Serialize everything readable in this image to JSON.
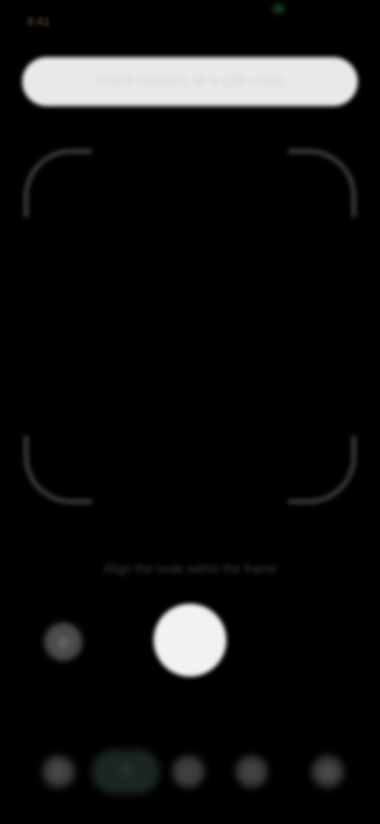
{
  "status_bar": {
    "time": "9:41",
    "camera_indicator_color": "#1f4a24"
  },
  "prompt_banner": {
    "text": "Point camera at a QR code"
  },
  "viewfinder": {
    "corner_color": "#3a3a3a"
  },
  "hint": {
    "text": "Align the code within the frame"
  },
  "controls": {
    "gallery_icon": "image-icon",
    "shutter_icon": "shutter-icon"
  },
  "bottom_nav": {
    "items": [
      {
        "icon": "translate-icon"
      },
      {
        "icon": "text-icon",
        "active": true
      },
      {
        "icon": "search-icon"
      },
      {
        "icon": "homework-icon"
      },
      {
        "icon": "shopping-icon"
      }
    ]
  },
  "colors": {
    "background": "#000000",
    "banner": "#e9e9e9",
    "shutter": "#f2f2f2",
    "active_nav": "#1a2620"
  }
}
